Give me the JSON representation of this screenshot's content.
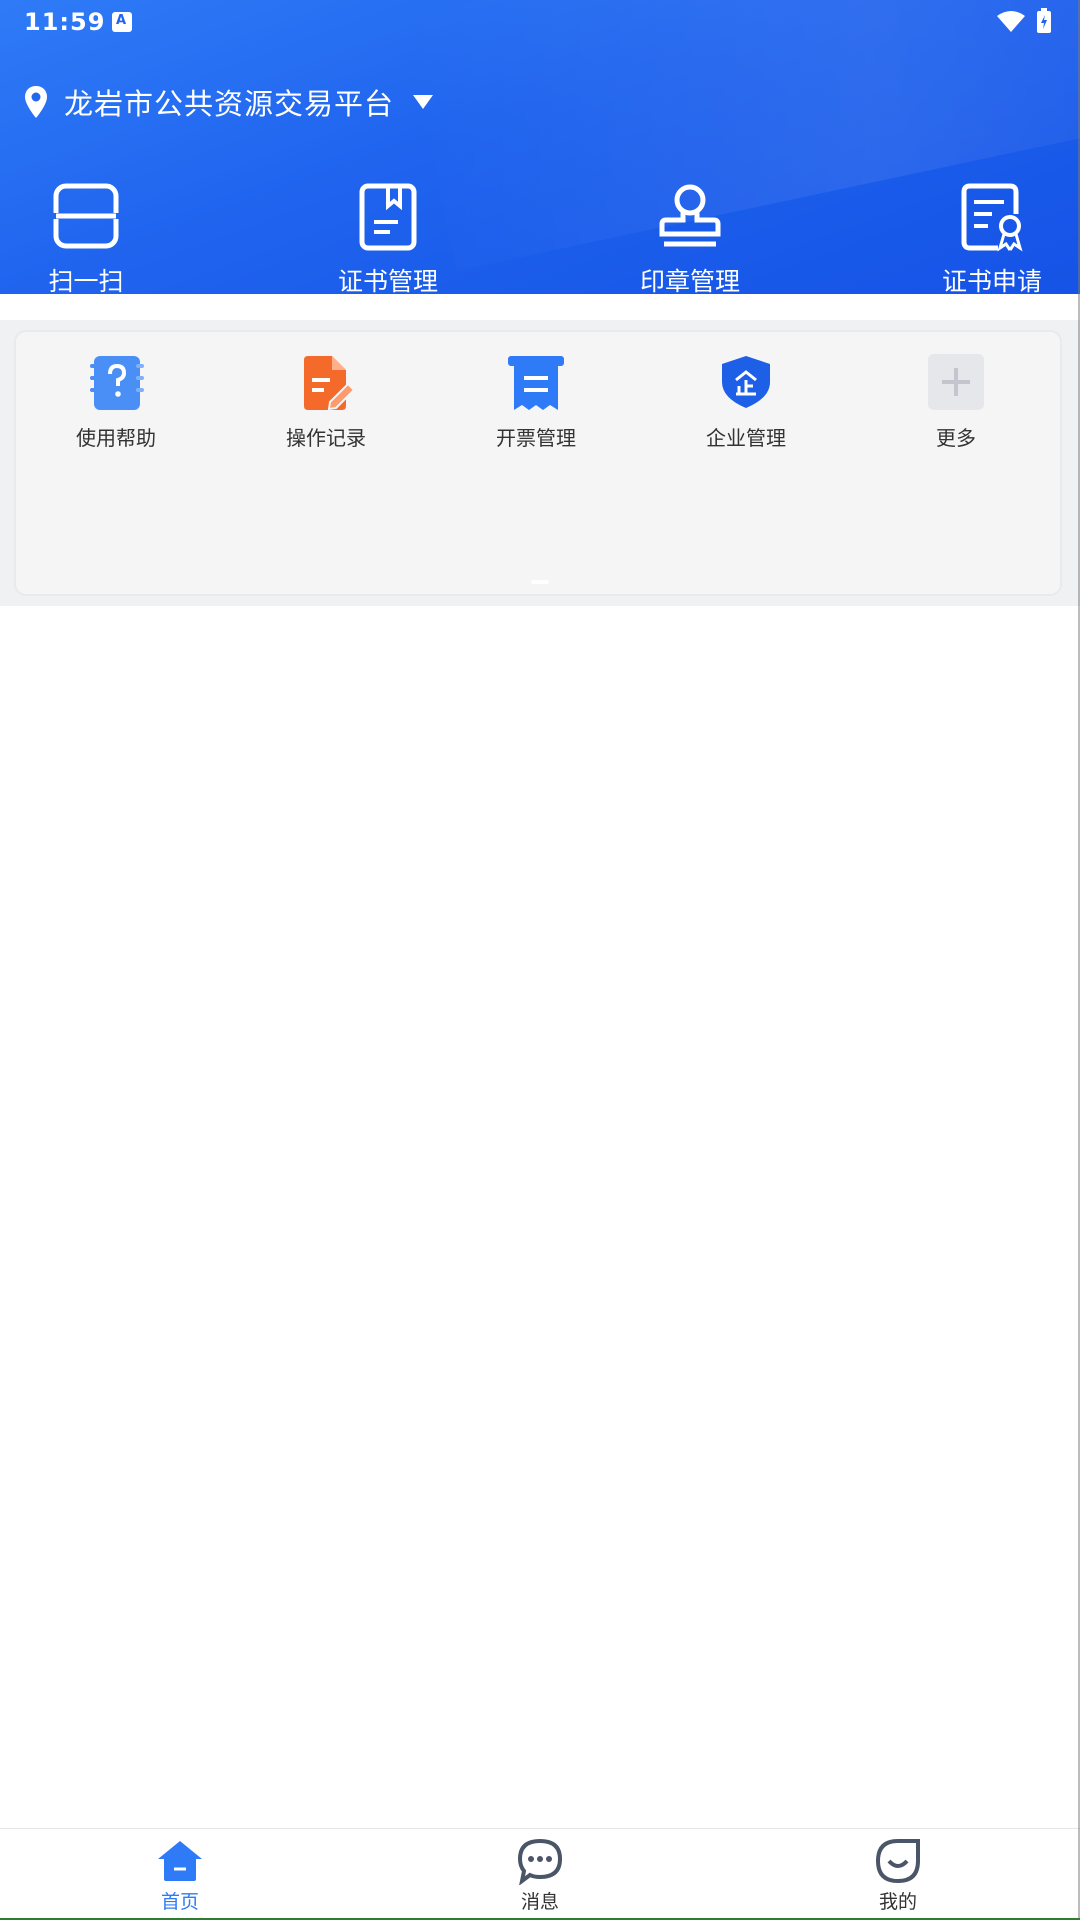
{
  "status_bar": {
    "time": "11:59"
  },
  "header": {
    "location": "龙岩市公共资源交易平台"
  },
  "top_actions": [
    {
      "label": "扫一扫",
      "icon": "scan-icon"
    },
    {
      "label": "证书管理",
      "icon": "certificate-book-icon"
    },
    {
      "label": "印章管理",
      "icon": "stamp-icon"
    },
    {
      "label": "证书申请",
      "icon": "certificate-apply-icon"
    }
  ],
  "grid_items": [
    {
      "label": "使用帮助",
      "icon": "help-notebook-icon",
      "color": "#4a8ff5"
    },
    {
      "label": "操作记录",
      "icon": "record-edit-icon",
      "color": "#f46a2b"
    },
    {
      "label": "开票管理",
      "icon": "invoice-icon",
      "color": "#2f7bf7"
    },
    {
      "label": "企业管理",
      "icon": "enterprise-shield-icon",
      "color": "#1d5fe6"
    },
    {
      "label": "更多",
      "icon": "plus-icon",
      "color": "#e6e7ea"
    }
  ],
  "tabbar": [
    {
      "label": "首页",
      "icon": "home-icon",
      "active": true
    },
    {
      "label": "消息",
      "icon": "message-icon",
      "active": false
    },
    {
      "label": "我的",
      "icon": "profile-icon",
      "active": false
    }
  ],
  "colors": {
    "primary": "#1f63ee",
    "active_tab": "#2f7bf7",
    "inactive_tab": "#333333"
  }
}
